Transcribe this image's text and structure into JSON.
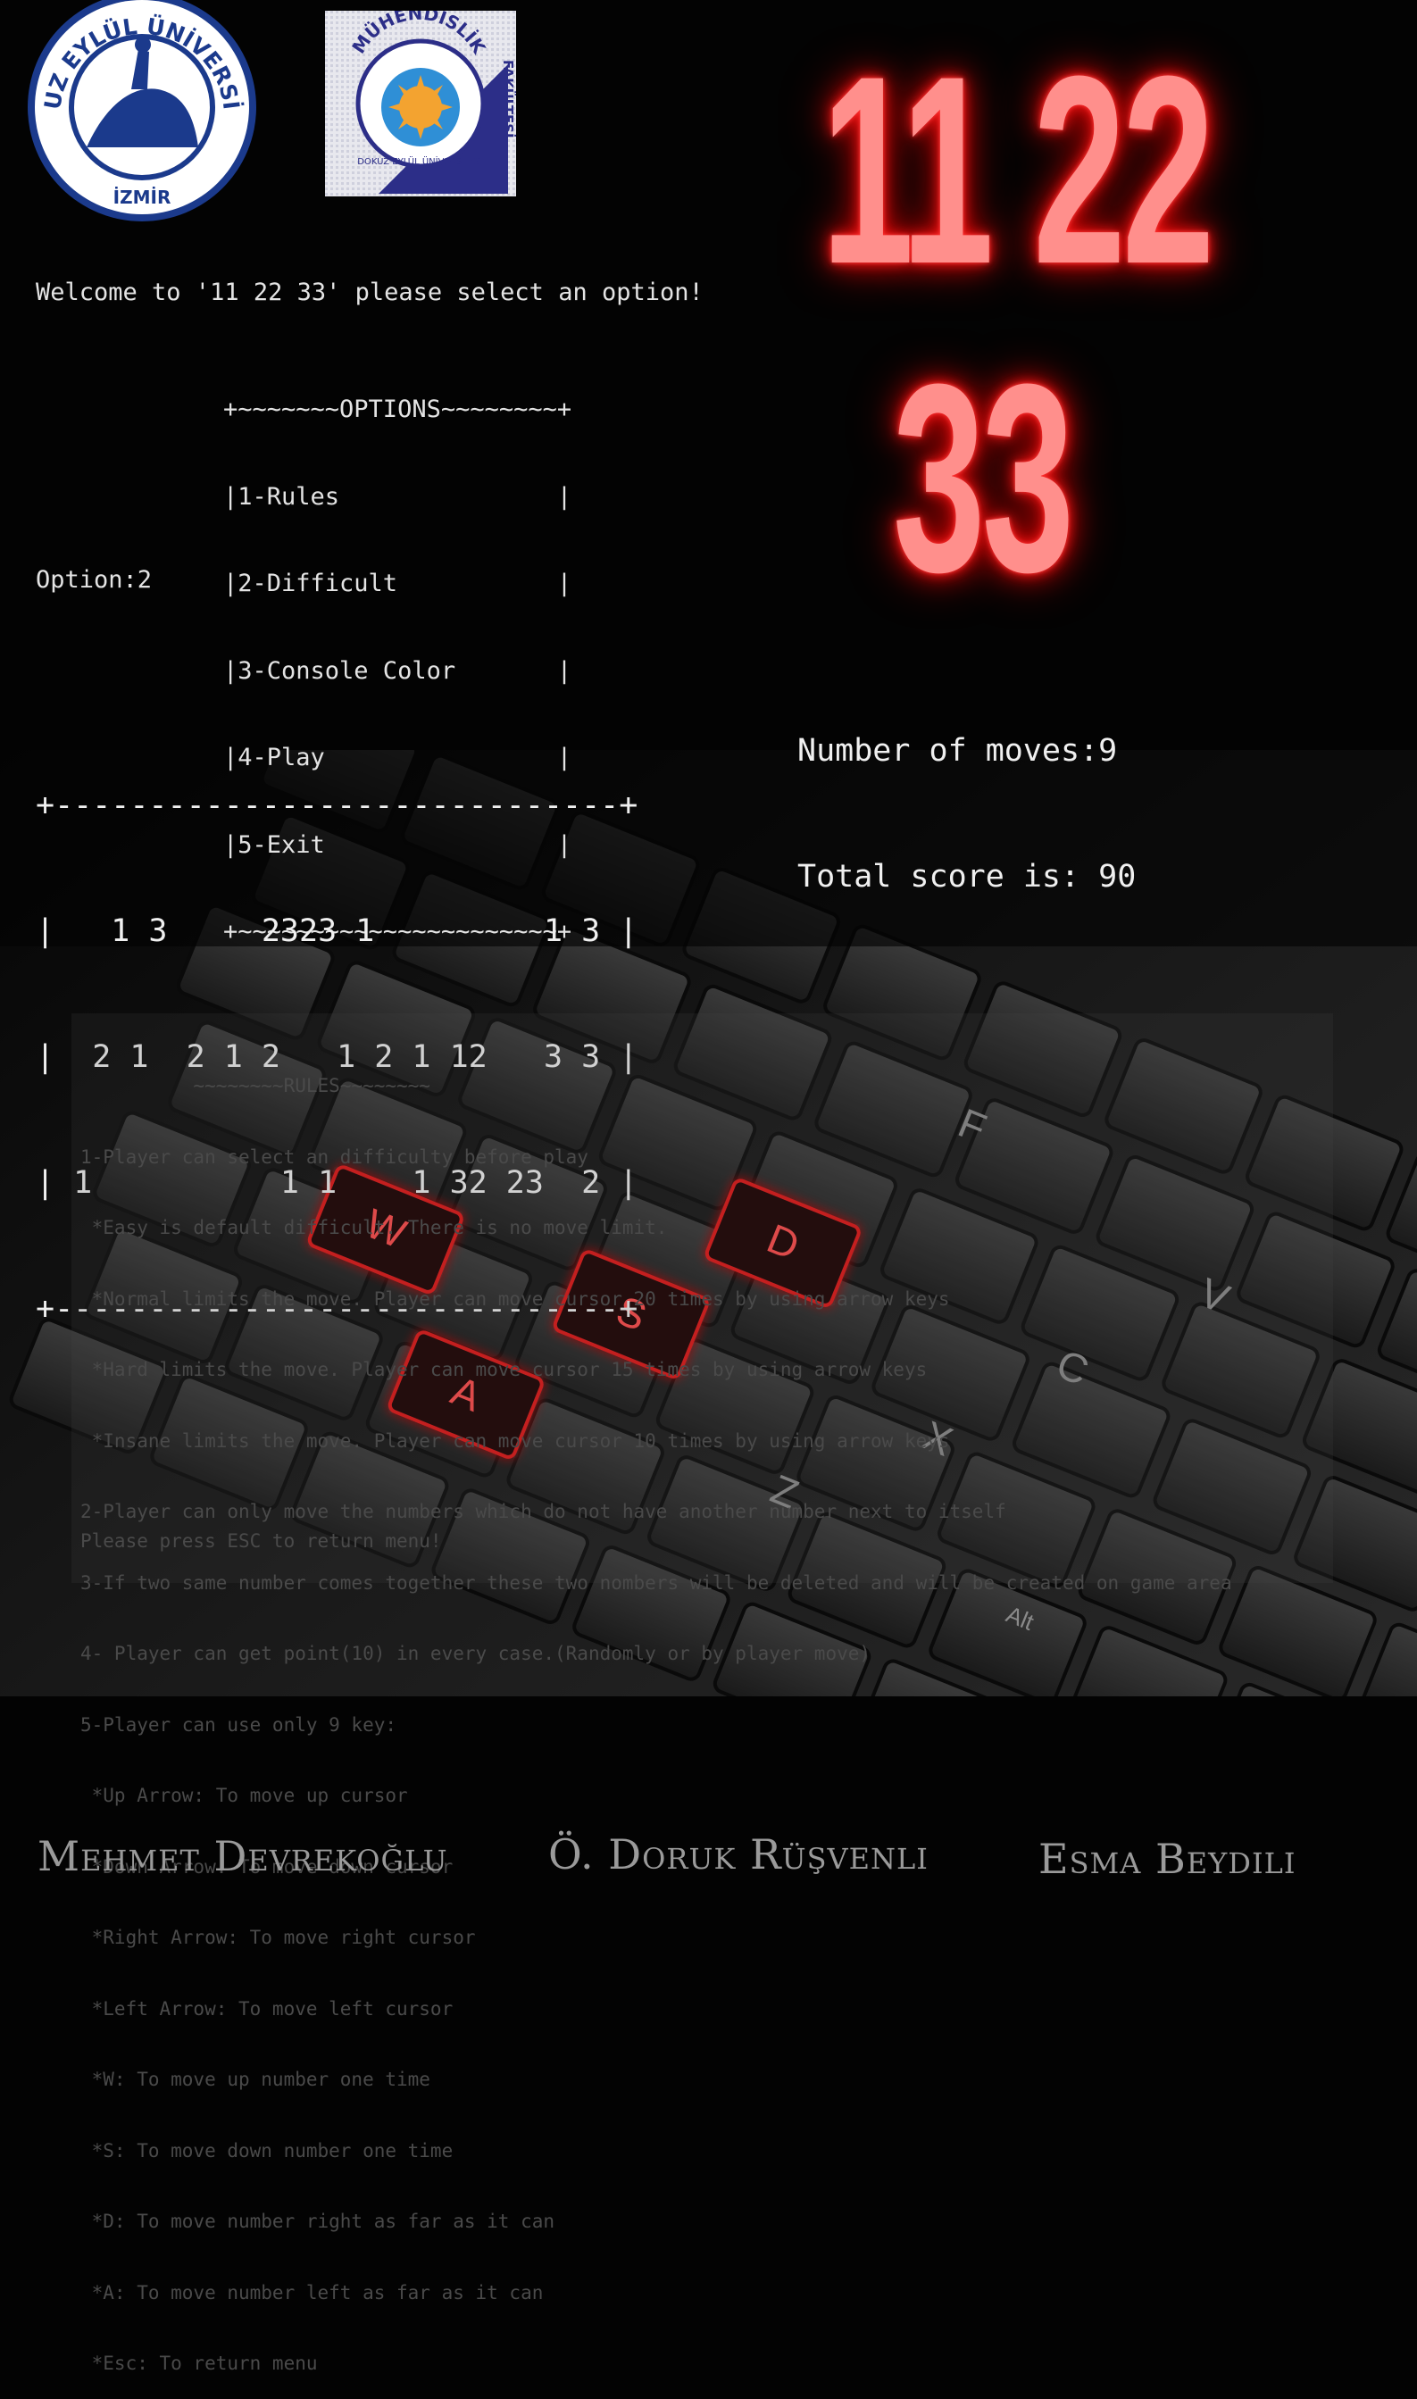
{
  "logos": {
    "left_logo_text": "DOKUZ EYLÜL ÜNİVERSİTESİ",
    "left_logo_city": "İZMİR",
    "right_logo_top": "MÜHENDİSLİK",
    "right_logo_side": "FAKÜLTESİ",
    "right_logo_inner": "DOKUZ EYLÜL ÜNİVERSİTESİ"
  },
  "title": {
    "line1": "11 22",
    "line2": "33"
  },
  "console": {
    "welcome": "Welcome to '11 22 33' please select an option!",
    "options_box": [
      "+~~~~~~~OPTIONS~~~~~~~~+",
      "|1-Rules               |",
      "|2-Difficult           |",
      "|3-Console Color       |",
      "|4-Play                |",
      "|5-Exit                |",
      "+~~~~~~~~~~~~~~~~~~~~~~+"
    ],
    "option_prompt": "Option:2"
  },
  "game": {
    "board": [
      "+------------------------------+",
      "|   1 3     2323 1         1 3 |",
      "|  2 1  2 1 2   1 2 1 12   3 3 |",
      "| 1          1 1    1 32 23  2 |",
      "+------------------------------+"
    ],
    "moves_text": "Number of moves:9",
    "score_text": "Total score is: 90"
  },
  "rules": {
    "lines": [
      "          ~~~~~~~~RULES~~~~~~~~",
      "1-Player can select an difficulty before play",
      " *Easy is default difficult. There is no move limit.",
      " *Normal limits the move. Player can move cursor 20 times by using arrow keys",
      " *Hard limits the move. Player can move cursor 15 times by using arrow keys",
      " *Insane limits the move. Player can move cursor 10 times by using arrow keys",
      "2-Player can only move the numbers which do not have another number next to itself",
      "3-If two same number comes together these two nombers will be deleted and will be created on game area",
      "4- Player can get point(10) in every case.(Randomly or by player move)",
      "5-Player can use only 9 key:",
      " *Up Arrow: To move up cursor",
      " *Down Arrow: To move down cursor",
      " *Right Arrow: To move right cursor",
      " *Left Arrow: To move left cursor",
      " *W: To move up number one time",
      " *S: To move down number one time",
      " *D: To move number right as far as it can",
      " *A: To move number left as far as it can",
      " *Esc: To return menu"
    ],
    "esc_prompt": "Please press ESC to return menu!"
  },
  "keyboard": {
    "highlighted_keys": [
      "W",
      "A",
      "S",
      "D"
    ],
    "other_keys": [
      "X",
      "C",
      "V",
      "F",
      "Z",
      "Alt"
    ]
  },
  "authors": [
    "Mehmet Devrekoğlu",
    "Ö. Doruk Rüşvenli",
    "Esma Beydili"
  ],
  "colors": {
    "neon": "#ff8f8c",
    "glow": "#ff1d1d",
    "background": "#030303",
    "key_red": "#e01818"
  }
}
